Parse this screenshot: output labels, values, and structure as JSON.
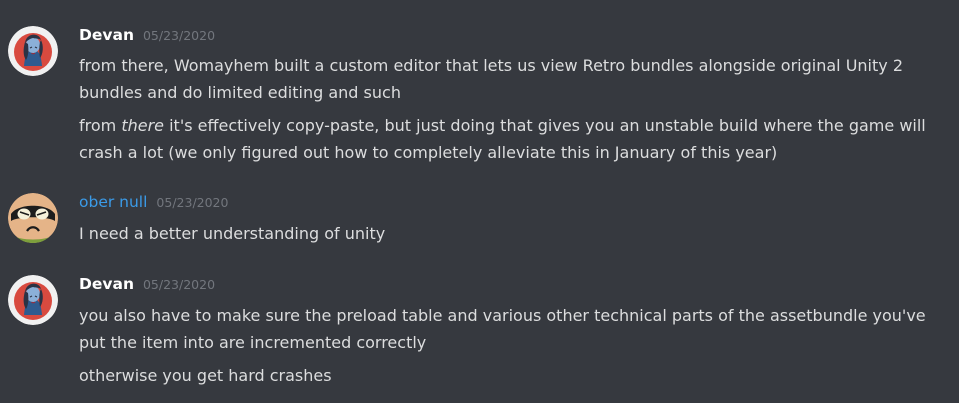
{
  "messages": [
    {
      "author": "Devan",
      "timestamp": "05/23/2020",
      "lines": [
        {
          "text": "from there, Womayhem built a custom editor that lets us view Retro bundles alongside original Unity 2 bundles and do limited editing and such"
        },
        {
          "before": "from ",
          "emphasis": "there",
          "after": " it's effectively copy-paste, but just doing that gives you an unstable build where the game will crash a lot (we only figured out how to completely alleviate this in January of this year)"
        }
      ]
    },
    {
      "author": "ober null",
      "timestamp": "05/23/2020",
      "lines": [
        {
          "text": "I need a better understanding of unity"
        }
      ]
    },
    {
      "author": "Devan",
      "timestamp": "05/23/2020",
      "lines": [
        {
          "text": "you also have to make sure the preload table and various other technical parts of the assetbundle you've put the item into are incremented correctly"
        },
        {
          "text": "otherwise you get hard crashes"
        }
      ]
    }
  ],
  "colors": {
    "background": "#36393f",
    "text": "#dcddde",
    "timestamp": "#72767d",
    "devan_name": "#ffffff",
    "ober_null_name": "#3b9be8"
  }
}
